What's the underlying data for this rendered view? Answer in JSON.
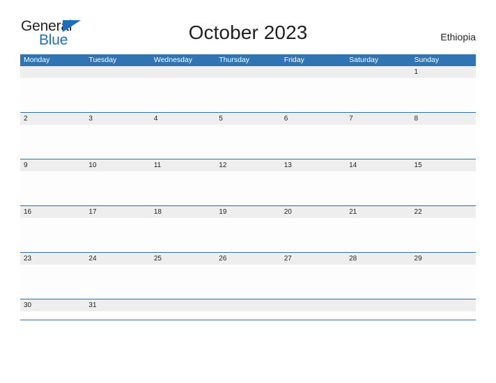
{
  "brand": {
    "word_one": "General",
    "word_two": "Blue",
    "flag_icon": "triangle-flag-icon",
    "color_blue": "#1f6fb8",
    "color_black": "#231f20"
  },
  "header": {
    "title": "October 2023",
    "region": "Ethiopia"
  },
  "calendar": {
    "accent_color": "#3174b4",
    "band_color": "#eeeeee",
    "rule_color": "#2d6fae",
    "weekdays": [
      "Monday",
      "Tuesday",
      "Wednesday",
      "Thursday",
      "Friday",
      "Saturday",
      "Sunday"
    ],
    "weeks": [
      [
        "",
        "",
        "",
        "",
        "",
        "",
        "1"
      ],
      [
        "2",
        "3",
        "4",
        "5",
        "6",
        "7",
        "8"
      ],
      [
        "9",
        "10",
        "11",
        "12",
        "13",
        "14",
        "15"
      ],
      [
        "16",
        "17",
        "18",
        "19",
        "20",
        "21",
        "22"
      ],
      [
        "23",
        "24",
        "25",
        "26",
        "27",
        "28",
        "29"
      ],
      [
        "30",
        "31",
        "",
        "",
        "",
        "",
        ""
      ]
    ]
  }
}
